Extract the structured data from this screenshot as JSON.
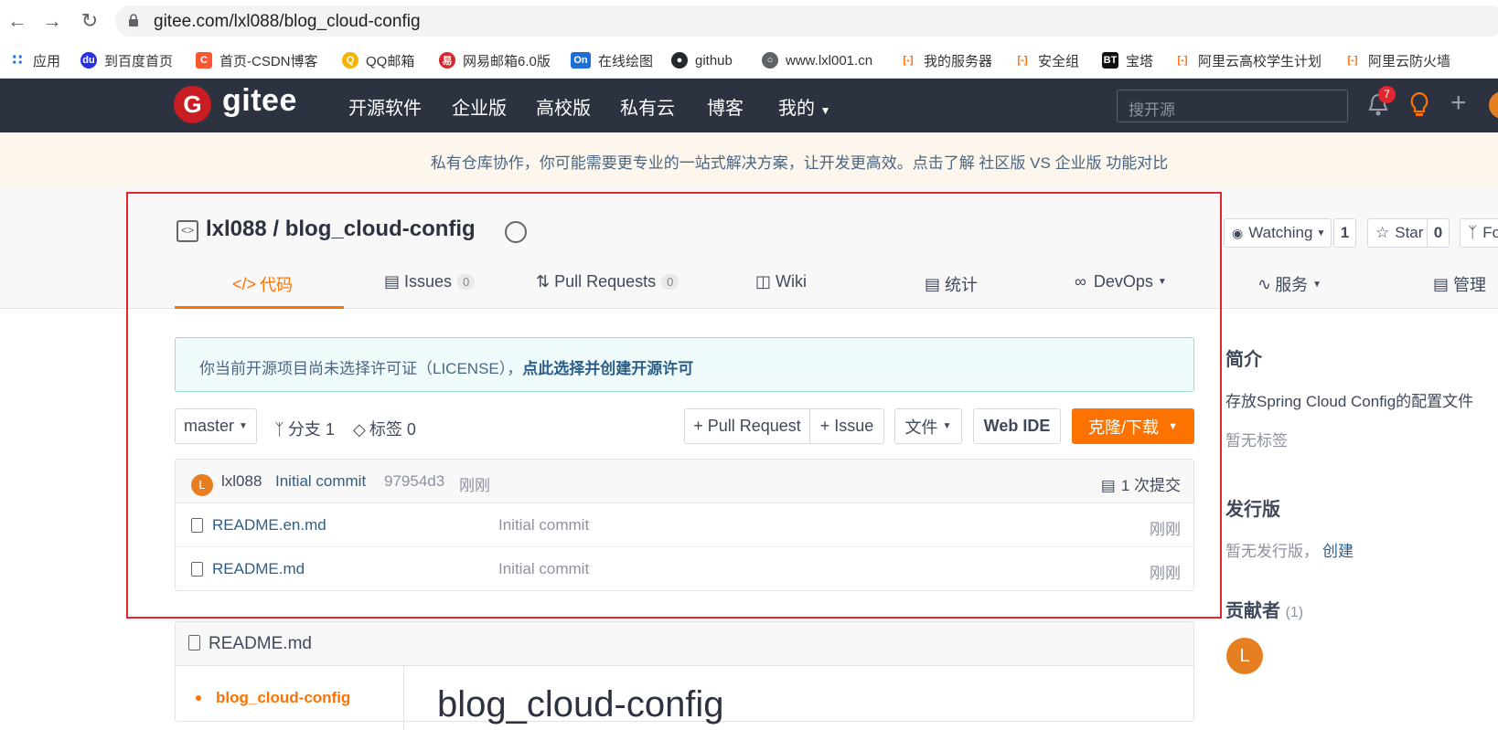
{
  "browser": {
    "url": "gitee.com/lxl088/blog_cloud-config",
    "bookmarks": [
      {
        "label": "应用",
        "icon": "apps-grid-icon",
        "color": "#1a73e8"
      },
      {
        "label": "到百度首页",
        "icon": "baidu-paw-icon",
        "color": "#2932e1"
      },
      {
        "label": "首页-CSDN博客",
        "icon": "csdn-c-icon",
        "color": "#fc5531"
      },
      {
        "label": "QQ邮箱",
        "icon": "qq-mail-icon",
        "color": "#f4b400"
      },
      {
        "label": "网易邮箱6.0版",
        "icon": "netease-mail-icon",
        "color": "#d8282f"
      },
      {
        "label": "在线绘图",
        "icon": "on-icon",
        "color": "#1d6fd6"
      },
      {
        "label": "github",
        "icon": "github-cat-icon",
        "color": "#24292e"
      },
      {
        "label": "www.lxl001.cn",
        "icon": "globe-icon",
        "color": "#5f6368"
      },
      {
        "label": "我的服务器",
        "icon": "aliyun-icon",
        "color": "#ff6a00"
      },
      {
        "label": "安全组",
        "icon": "aliyun-icon",
        "color": "#ff6a00"
      },
      {
        "label": "宝塔",
        "icon": "bt-icon",
        "color": "#111111"
      },
      {
        "label": "阿里云高校学生计划",
        "icon": "aliyun-icon",
        "color": "#ff6a00"
      },
      {
        "label": "阿里云防火墙",
        "icon": "aliyun-icon",
        "color": "#ff6a00"
      }
    ]
  },
  "header": {
    "logo_letter": "G",
    "logo_text": "gitee",
    "nav": [
      "开源软件",
      "企业版",
      "高校版",
      "私有云",
      "博客",
      "我的"
    ],
    "search_placeholder": "搜开源",
    "notification_count": "7"
  },
  "banner": {
    "text": "私有仓库协作，你可能需要更专业的一站式解决方案，让开发更高效。点击了解 社区版 VS 企业版 功能对比"
  },
  "repo": {
    "title": "lxl088 / blog_cloud-config",
    "watching_label": "Watching",
    "watching_count": "1",
    "star_label": "Star",
    "star_count": "0",
    "fork_label": "Fo",
    "tabs": [
      {
        "label": "代码",
        "icon": "code-icon"
      },
      {
        "label": "Issues",
        "count": "0",
        "icon": "issues-icon"
      },
      {
        "label": "Pull Requests",
        "count": "0",
        "icon": "pull-request-icon"
      },
      {
        "label": "Wiki",
        "icon": "wiki-book-icon"
      },
      {
        "label": "统计",
        "icon": "bar-chart-icon"
      },
      {
        "label": "DevOps",
        "icon": "infinity-icon"
      },
      {
        "label": "服务",
        "icon": "pulse-icon"
      },
      {
        "label": "管理",
        "icon": "manage-doc-icon"
      }
    ]
  },
  "license": {
    "notice": "你当前开源项目尚未选择许可证（LICENSE），",
    "link": "点此选择并创建开源许可"
  },
  "toolbar": {
    "branch": "master",
    "branches": "分支 1",
    "tags": "标签 0",
    "pull_request": "+ Pull Request",
    "issue": "+ Issue",
    "files": "文件",
    "web_ide": "Web IDE",
    "clone": "克隆/下载"
  },
  "commit": {
    "avatar_letter": "L",
    "author": "lxl088",
    "message": "Initial commit",
    "hash": "97954d3",
    "time": "刚刚",
    "count": "1 次提交"
  },
  "files": [
    {
      "name": "README.en.md",
      "message": "Initial commit",
      "time": "刚刚"
    },
    {
      "name": "README.md",
      "message": "Initial commit",
      "time": "刚刚"
    }
  ],
  "readme": {
    "title": "README.md",
    "toc_item": "blog_cloud-config",
    "heading": "blog_cloud-config"
  },
  "sidebar": {
    "intro_title": "简介",
    "intro_text": "存放Spring Cloud Config的配置文件",
    "no_tags": "暂无标签",
    "release_title": "发行版",
    "no_release": "暂无发行版，",
    "create_link": "创建",
    "contributors_title": "贡献者",
    "contributors_count": "(1)",
    "contributor_avatar": "L"
  }
}
